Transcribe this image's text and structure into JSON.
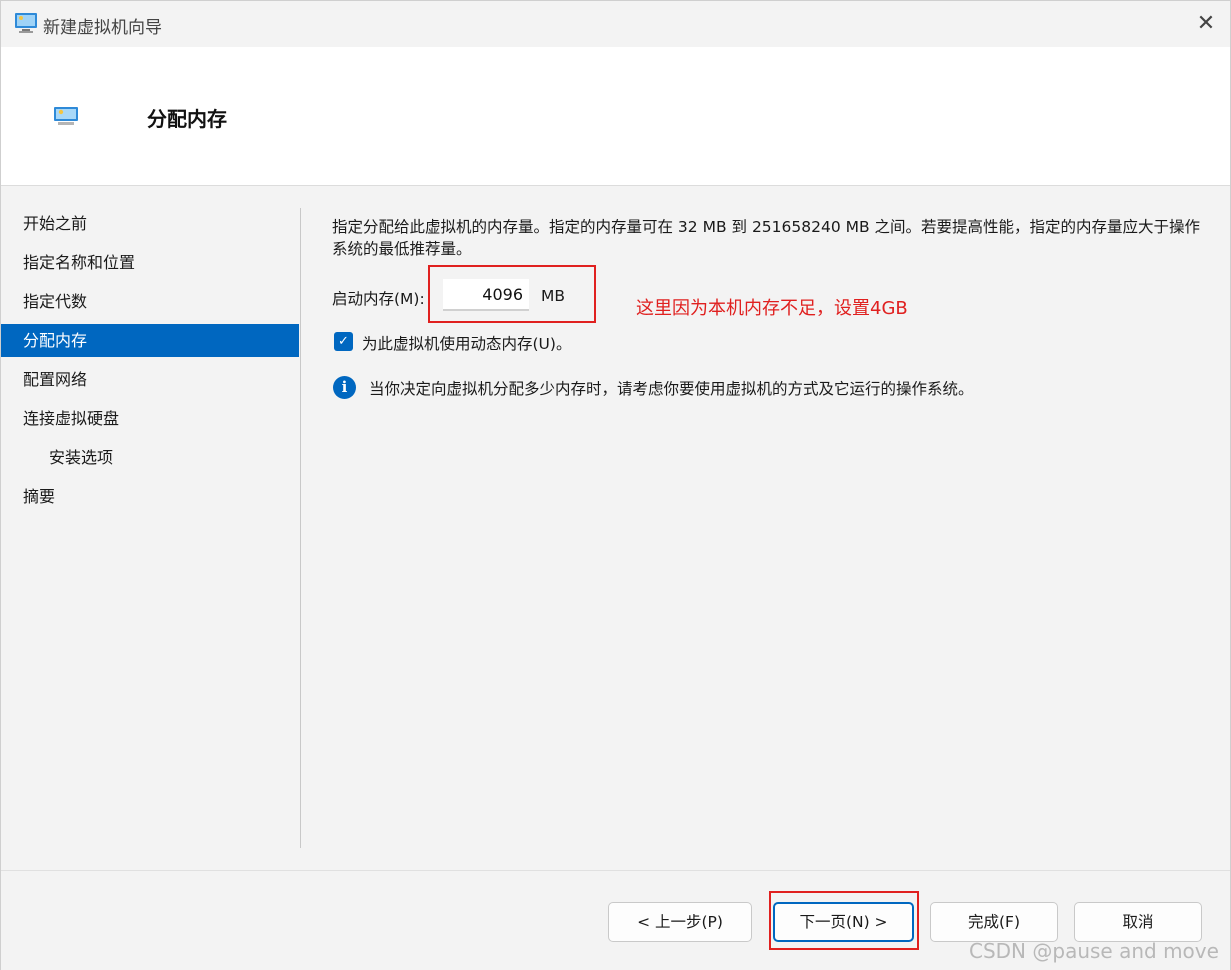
{
  "window": {
    "title": "新建虚拟机向导",
    "close_glyph": "✕"
  },
  "header": {
    "title": "分配内存"
  },
  "sidebar": {
    "items": [
      {
        "label": "开始之前"
      },
      {
        "label": "指定名称和位置"
      },
      {
        "label": "指定代数"
      },
      {
        "label": "分配内存",
        "active": true
      },
      {
        "label": "配置网络"
      },
      {
        "label": "连接虚拟硬盘"
      },
      {
        "label": "安装选项",
        "sub": true
      },
      {
        "label": "摘要"
      }
    ]
  },
  "content": {
    "description": "指定分配给此虚拟机的内存量。指定的内存量可在 32 MB 到 251658240 MB 之间。若要提高性能，指定的内存量应大于操作系统的最低推荐量。",
    "startup_memory_label": "启动内存(M):",
    "startup_memory_value": "4096",
    "memory_unit": "MB",
    "annotation": "这里因为本机内存不足，设置4GB",
    "dynamic_memory_label": "为此虚拟机使用动态内存(U)。",
    "dynamic_memory_checked": true,
    "checkbox_glyph": "✓",
    "info_glyph": "i",
    "info_text": "当你决定向虚拟机分配多少内存时，请考虑你要使用虚拟机的方式及它运行的操作系统。"
  },
  "footer": {
    "back_label": "< 上一步(P)",
    "next_label": "下一页(N) >",
    "finish_label": "完成(F)",
    "cancel_label": "取消"
  },
  "watermark": "CSDN @pause and move",
  "colors": {
    "accent": "#0067c0",
    "annotation_red": "#e0201f"
  }
}
